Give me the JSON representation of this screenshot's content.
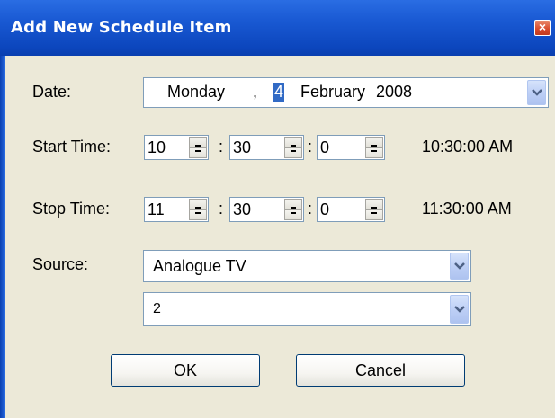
{
  "window": {
    "title": "Add New Schedule Item",
    "close_glyph": "×"
  },
  "form": {
    "date": {
      "label": "Date:",
      "weekday": "Monday",
      "separator": ",",
      "day": "4",
      "month": "February",
      "year": "2008"
    },
    "start_time": {
      "label": "Start Time:",
      "hour": "10",
      "minute": "30",
      "second": "0",
      "colon": ":",
      "display": "10:30:00 AM"
    },
    "stop_time": {
      "label": "Stop Time:",
      "hour": "11",
      "minute": "30",
      "second": "0",
      "colon": ":",
      "display": "11:30:00 AM"
    },
    "source": {
      "label": "Source:",
      "selected": "Analogue TV",
      "channel": "2"
    }
  },
  "buttons": {
    "ok": "OK",
    "cancel": "Cancel"
  },
  "icons": {
    "close": "close-icon",
    "dropdown": "chevron-down-icon",
    "spin_up": "spin-up-icon",
    "spin_down": "spin-down-icon"
  }
}
